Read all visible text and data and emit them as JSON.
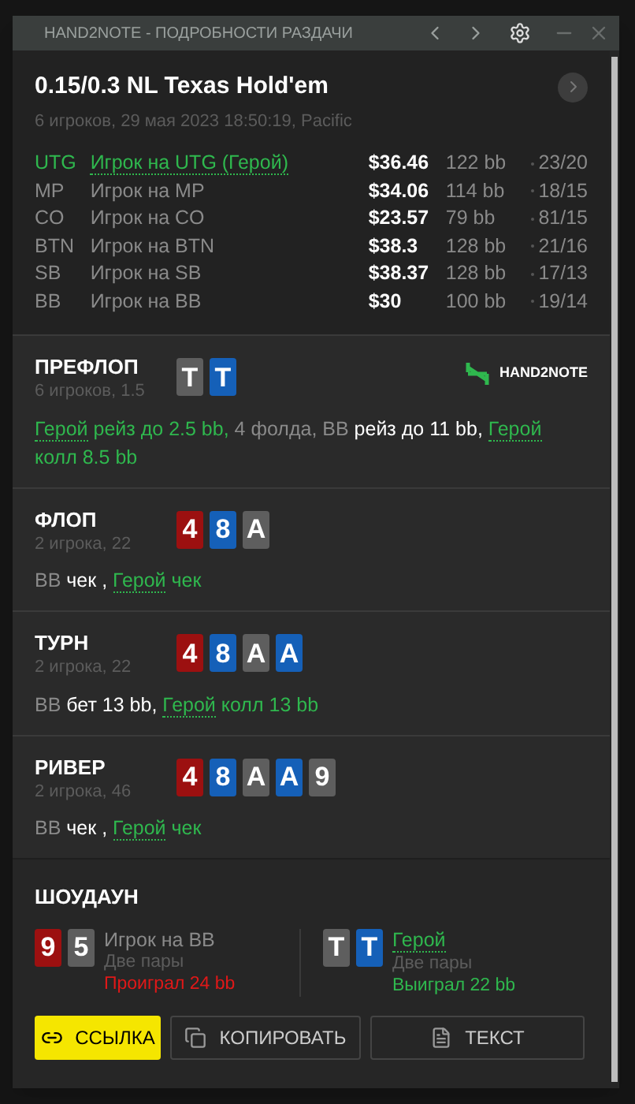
{
  "window": {
    "title": "HAND2NOTE - ПОДРОБНОСТИ РАЗДАЧИ"
  },
  "header": {
    "game": "0.15/0.3 NL Texas Hold'em",
    "info": "6 игроков, 29 мая 2023 18:50:19, Pacific"
  },
  "seats": [
    {
      "position": "UTG",
      "player": "Игрок на UTG (Герой)",
      "hero": true,
      "stack": "$36.46",
      "bb": "122 bb",
      "stats": "23/20"
    },
    {
      "position": "MP",
      "player": "Игрок на MP",
      "hero": false,
      "stack": "$34.06",
      "bb": "114 bb",
      "stats": "18/15"
    },
    {
      "position": "CO",
      "player": "Игрок на CO",
      "hero": false,
      "stack": "$23.57",
      "bb": "79 bb",
      "stats": "81/15"
    },
    {
      "position": "BTN",
      "player": "Игрок на BTN",
      "hero": false,
      "stack": "$38.3",
      "bb": "128 bb",
      "stats": "21/16"
    },
    {
      "position": "SB",
      "player": "Игрок на SB",
      "hero": false,
      "stack": "$38.37",
      "bb": "128 bb",
      "stats": "17/13"
    },
    {
      "position": "BB",
      "player": "Игрок на BB",
      "hero": false,
      "stack": "$30",
      "bb": "100 bb",
      "stats": "19/14"
    }
  ],
  "logo": {
    "text": "HAND2NOTE"
  },
  "streets": [
    {
      "name": "ПРЕФЛОП",
      "info": "6 игроков, 1.5",
      "cards": [
        {
          "rank": "T",
          "color": "#5e5e5e"
        },
        {
          "rank": "T",
          "color": "#1560b8"
        }
      ],
      "actions": [
        {
          "text": "Герой",
          "kind": "hero_name"
        },
        {
          "text": " рейз до 2.5 bb,",
          "kind": "hero"
        },
        {
          "text": " 4 фолда, BB",
          "kind": "player"
        },
        {
          "text": " рейз до 11 bb, ",
          "kind": "action"
        },
        {
          "text": "Герой",
          "kind": "hero_name"
        },
        {
          "text": " колл 8.5 bb",
          "kind": "hero"
        }
      ]
    },
    {
      "name": "ФЛОП",
      "info": "2 игрока, 22",
      "cards": [
        {
          "rank": "4",
          "color": "#9c1010"
        },
        {
          "rank": "8",
          "color": "#1560b8"
        },
        {
          "rank": "A",
          "color": "#5e5e5e"
        }
      ],
      "actions": [
        {
          "text": "BB",
          "kind": "player"
        },
        {
          "text": " чек , ",
          "kind": "action"
        },
        {
          "text": "Герой",
          "kind": "hero_name"
        },
        {
          "text": " чек",
          "kind": "hero"
        }
      ]
    },
    {
      "name": "ТУРН",
      "info": "2 игрока, 22",
      "cards": [
        {
          "rank": "4",
          "color": "#9c1010"
        },
        {
          "rank": "8",
          "color": "#1560b8"
        },
        {
          "rank": "A",
          "color": "#5e5e5e"
        },
        {
          "rank": "A",
          "color": "#1560b8"
        }
      ],
      "actions": [
        {
          "text": "BB",
          "kind": "player"
        },
        {
          "text": " бет 13 bb, ",
          "kind": "action"
        },
        {
          "text": "Герой",
          "kind": "hero_name"
        },
        {
          "text": " колл 13 bb",
          "kind": "hero"
        }
      ]
    },
    {
      "name": "РИВЕР",
      "info": "2 игрока, 46",
      "cards": [
        {
          "rank": "4",
          "color": "#9c1010"
        },
        {
          "rank": "8",
          "color": "#1560b8"
        },
        {
          "rank": "A",
          "color": "#5e5e5e"
        },
        {
          "rank": "A",
          "color": "#1560b8"
        },
        {
          "rank": "9",
          "color": "#5e5e5e"
        }
      ],
      "actions": [
        {
          "text": "BB",
          "kind": "player"
        },
        {
          "text": " чек , ",
          "kind": "action"
        },
        {
          "text": "Герой",
          "kind": "hero_name"
        },
        {
          "text": " чек",
          "kind": "hero"
        }
      ]
    }
  ],
  "showdown": {
    "title": "ШОУДАУН",
    "players": [
      {
        "name": "Игрок на BB",
        "hero": false,
        "hand": "Две пары",
        "result": "Проиграл 24 bb",
        "won": false,
        "cards": [
          {
            "rank": "9",
            "color": "#9c1010"
          },
          {
            "rank": "5",
            "color": "#5e5e5e"
          }
        ]
      },
      {
        "name": "Герой",
        "hero": true,
        "hand": "Две пары",
        "result": "Выиграл 22 bb",
        "won": true,
        "cards": [
          {
            "rank": "T",
            "color": "#5e5e5e"
          },
          {
            "rank": "T",
            "color": "#1560b8"
          }
        ]
      }
    ]
  },
  "buttons": [
    {
      "label": "ССЫЛКА",
      "kind": "link"
    },
    {
      "label": "КОПИРОВАТЬ",
      "kind": "copy"
    },
    {
      "label": "ТЕКСТ",
      "kind": "text"
    }
  ]
}
